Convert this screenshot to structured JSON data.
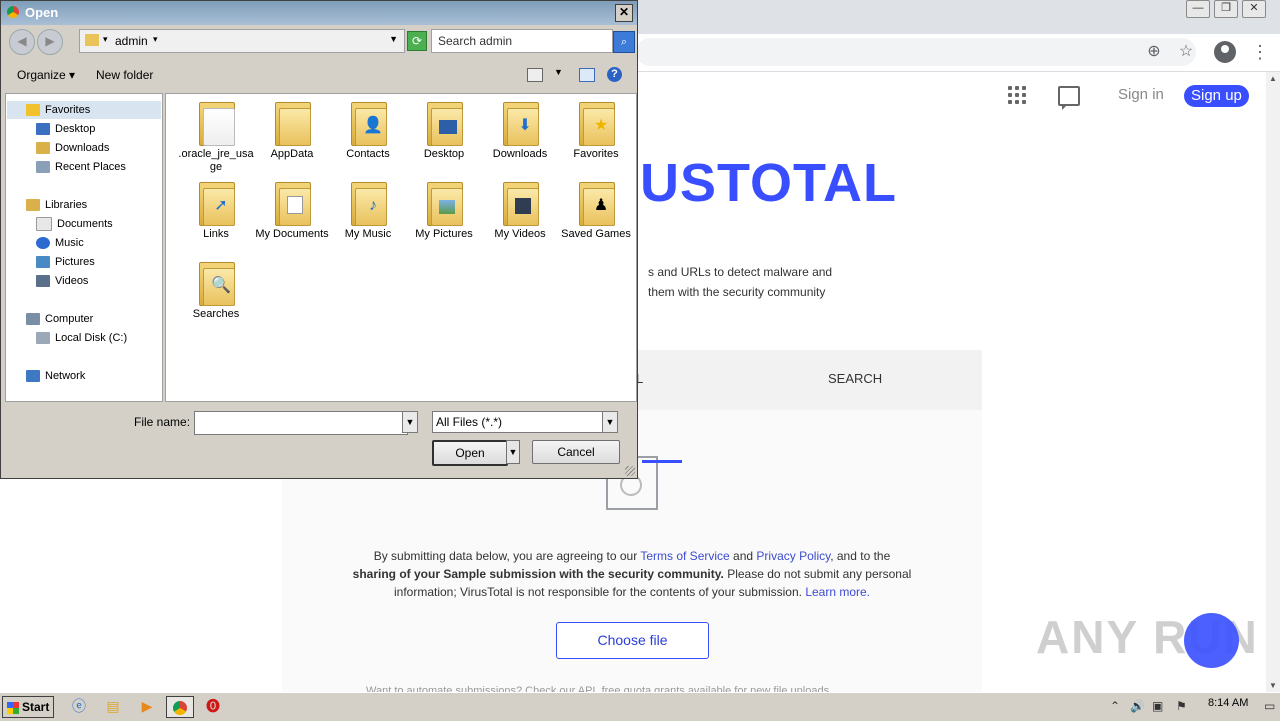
{
  "browser": {
    "window_controls": [
      "—",
      "❐",
      "✕"
    ],
    "toolbar_icons": [
      "zoom-icon",
      "star-icon",
      "profile-icon",
      "menu-icon"
    ],
    "virustotal": {
      "sign_in": "Sign in",
      "sign_up": "Sign up",
      "logo_text": "USTOTAL",
      "description_line1": "s and URLs to detect malware and",
      "description_line2": "them with the security community",
      "tab_partial": "L",
      "tab_search": "SEARCH",
      "terms_before": "By submitting data below, you are agreeing to our",
      "terms_link": "Terms of Service",
      "terms_and": "and",
      "privacy_link": "Privacy Policy",
      "terms_after": ", and to the",
      "terms_line2_bold": "sharing of your Sample submission with the security community.",
      "terms_line2_rest": "Please do not submit any personal",
      "terms_line3": "information; VirusTotal is not responsible for the contents of your submission.",
      "learn_more": "Learn more.",
      "choose_file": "Choose file",
      "footer_partial": "Want to automate submissions? Check our API, free quota grants available for new file uploads"
    },
    "watermark": "ANY RUN"
  },
  "dialog": {
    "title": "Open",
    "close_label": "✕",
    "address_segment": "admin",
    "search_placeholder": "Search admin",
    "organize_label": "Organize",
    "new_folder_label": "New folder",
    "help_label": "?",
    "nav": {
      "favorites": "Favorites",
      "desktop": "Desktop",
      "downloads": "Downloads",
      "recent_places": "Recent Places",
      "libraries": "Libraries",
      "documents": "Documents",
      "music": "Music",
      "pictures": "Pictures",
      "videos": "Videos",
      "computer": "Computer",
      "local_disk": "Local Disk (C:)",
      "network": "Network"
    },
    "items": [
      {
        "label": ".oracle_jre_usage",
        "icon": "folder-plain-icon"
      },
      {
        "label": "AppData",
        "icon": "folder-plain-icon"
      },
      {
        "label": "Contacts",
        "icon": "contacts-folder-icon"
      },
      {
        "label": "Desktop",
        "icon": "desktop-folder-icon"
      },
      {
        "label": "Downloads",
        "icon": "downloads-folder-icon"
      },
      {
        "label": "Favorites",
        "icon": "favorites-folder-icon"
      },
      {
        "label": "Links",
        "icon": "links-folder-icon"
      },
      {
        "label": "My Documents",
        "icon": "documents-folder-icon"
      },
      {
        "label": "My Music",
        "icon": "music-folder-icon"
      },
      {
        "label": "My Pictures",
        "icon": "pictures-folder-icon"
      },
      {
        "label": "My Videos",
        "icon": "videos-folder-icon"
      },
      {
        "label": "Saved Games",
        "icon": "saved-games-folder-icon"
      },
      {
        "label": "Searches",
        "icon": "searches-folder-icon"
      }
    ],
    "file_name_label": "File name:",
    "file_name_value": "",
    "file_type": "All Files (*.*)",
    "open_label": "Open",
    "cancel_label": "Cancel"
  },
  "taskbar": {
    "start_label": "Start",
    "apps": [
      "ie-icon",
      "explorer-icon",
      "media-player-icon",
      "chrome-icon",
      "opera-icon"
    ],
    "clock": "8:14 AM"
  }
}
